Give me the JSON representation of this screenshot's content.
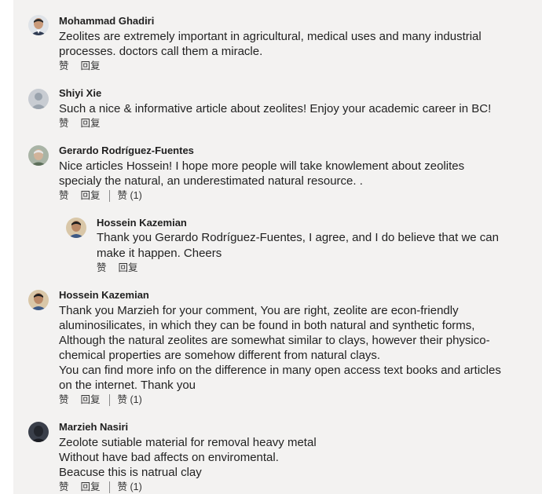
{
  "comments": [
    {
      "name": "Mohammad Ghadiri",
      "lines": [
        "Zeolites are extremely important in agricultural, medical uses and many industrial",
        "processes. doctors call them a miracle."
      ],
      "like": "赞",
      "reply": "回复"
    },
    {
      "name": "Shiyi Xie",
      "lines": [
        "Such a nice & informative article about zeolites! Enjoy your academic career in BC!"
      ],
      "like": "赞",
      "reply": "回复"
    },
    {
      "name": "Gerardo Rodríguez-Fuentes",
      "lines": [
        "Nice articles Hossein! I hope more people will take knowlement about zeolites",
        "specialy the natural, an underestimated natural resource. ."
      ],
      "like": "赞",
      "reply": "回复",
      "likes": "赞 (1)",
      "replies": [
        {
          "name": "Hossein Kazemian",
          "lines": [
            "Thank you Gerardo Rodríguez-Fuentes, I agree, and I do believe that we can",
            "make it happen. Cheers"
          ],
          "like": "赞",
          "reply": "回复"
        }
      ]
    },
    {
      "name": "Hossein Kazemian",
      "lines": [
        "Thank you Marzieh for your comment, You are right, zeolite are econ-friendly",
        "aluminosilicates, in which they can be found in both natural and synthetic forms,",
        "Although the natural zeolites are somewhat similar to clays, however their physico-",
        "chemical properties are somehow different from natural clays.",
        "You can find more info on the difference in many open access text books and articles",
        "on the internet. Thank you"
      ],
      "like": "赞",
      "reply": "回复",
      "likes": "赞 (1)"
    },
    {
      "name": "Marzieh Nasiri",
      "lines": [
        "Zeolote sutiable material for removal heavy metal",
        "Without have bad affects on enviromental.",
        "Beacuse this is natrual clay"
      ],
      "like": "赞",
      "reply": "回复",
      "likes": "赞 (1)"
    }
  ]
}
